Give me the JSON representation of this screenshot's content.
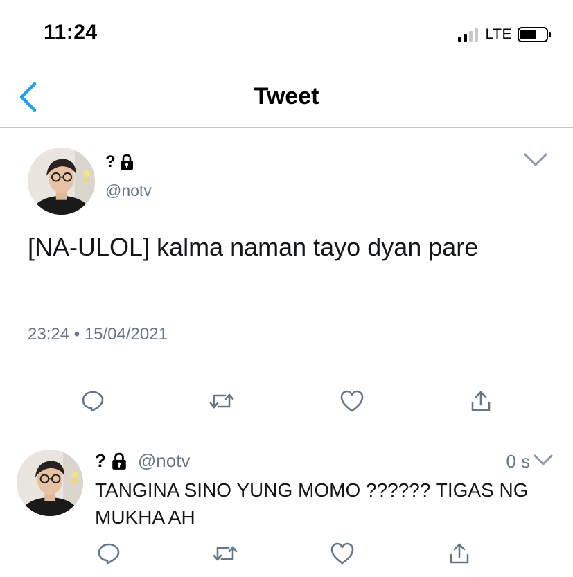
{
  "status": {
    "time": "11:24",
    "network": "LTE",
    "signal_bars_on": 2,
    "signal_bars_total": 4,
    "battery_level": 0.6
  },
  "nav": {
    "back_icon": "chevron-left-icon",
    "title": "Tweet"
  },
  "colors": {
    "accent": "#1da1f2",
    "secondary_text": "#657786",
    "divider": "#c8c8cc"
  },
  "main_tweet": {
    "name": "?",
    "protected_icon": "lock-icon",
    "handle": "@notv",
    "text": "[NA-ULOL] kalma naman tayo dyan pare",
    "time": "23:24",
    "separator": "•",
    "date": "15/04/2021",
    "actions": [
      "reply-icon",
      "retweet-icon",
      "like-icon",
      "share-icon"
    ]
  },
  "reply_tweet": {
    "name": "?",
    "protected_icon": "lock-icon",
    "handle": "@notv",
    "relative_time": "0 s",
    "text": "TANGINA SINO YUNG MOMO ?????? TIGAS NG MUKHA AH",
    "actions": [
      "reply-icon",
      "retweet-icon",
      "like-icon",
      "share-icon"
    ]
  }
}
